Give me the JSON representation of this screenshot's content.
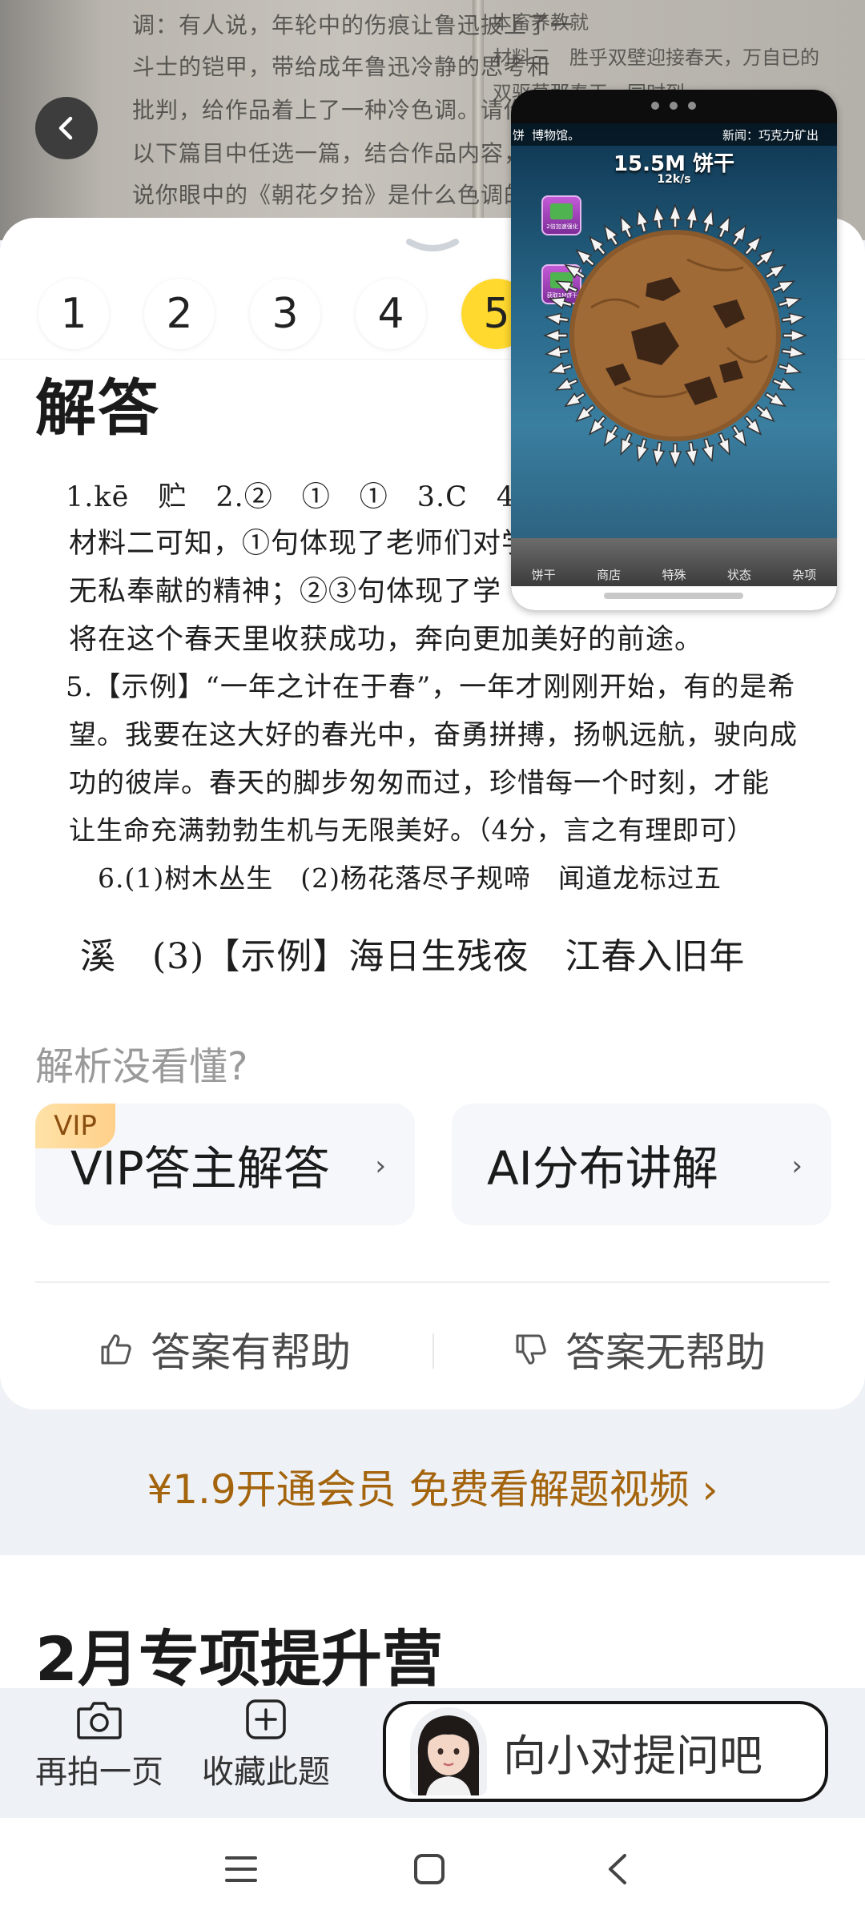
{
  "questions": {
    "numbers": [
      "1",
      "2",
      "3",
      "4",
      "5"
    ],
    "active_index": 4
  },
  "answer": {
    "title": "解答",
    "lines": [
      "1.kē　贮　2.②　①　①　3.C　4",
      "材料二可知，①句体现了老师们对学",
      "无私奉献的精神；②③句体现了学",
      "将在这个春天里收获成功，奔向更加美好的前途。",
      "5.【示例】“一年之计在于春”，一年才刚刚开始，有的是希",
      "望。我要在这大好的春光中，奋勇拼搏，扬帆远航，驶向成",
      "功的彼岸。春天的脚步匆匆而过，珍惜每一个时刻，才能",
      "让生命充满勃勃生机与无限美好。（4分，言之有理即可）",
      "6.(1)树木丛生　(2)杨花落尽子规啼　闻道龙标过五",
      "溪　(3)【示例】海日生残夜　江春入旧年"
    ]
  },
  "help": {
    "prompt": "解析没看懂?",
    "vip_badge": "VIP",
    "vip_card": "VIP答主解答",
    "ai_card": "AI分布讲解",
    "chevron": "›"
  },
  "feedback": {
    "helpful": "答案有帮助",
    "unhelpful": "答案无帮助"
  },
  "promo": "¥1.9开通会员 免费看解题视频 ›",
  "section2": {
    "title": "2月专项提升营"
  },
  "bottom": {
    "retake": "再拍一页",
    "favorite": "收藏此题",
    "ask": "向小对提问吧"
  },
  "background_text": {
    "lines": [
      "调：有人说，年轮中的伤痕让鲁迅披上了一",
      "斗士的铠甲，带给成年鲁迅冷静的思考和",
      "批判，给作品着上了一种冷色调。请你从",
      "以下篇目中任选一篇，结合作品内容，说",
      "说你眼中的《朝花夕拾》是什么色调的。"
    ],
    "right_lines": [
      "本畜养教就",
      "材料三　胜乎双壁迎接春天，万自已的",
      "双驱草那春天，同时到"
    ]
  },
  "game": {
    "news_left": "饼",
    "news_mid": "博物馆。",
    "news_right": "新闻：巧克力矿出",
    "cookie_count": "15.5M 饼干",
    "rate": "12k/s",
    "upgrade1": "2倍加速强化",
    "upgrade2": "获取1M饼干",
    "tabs": [
      "饼干",
      "商店",
      "特殊",
      "状态",
      "杂项"
    ]
  },
  "colors": {
    "active_number": "#ffd92e",
    "promo": "#a4640c",
    "vip_badge": "#ffd08a"
  }
}
